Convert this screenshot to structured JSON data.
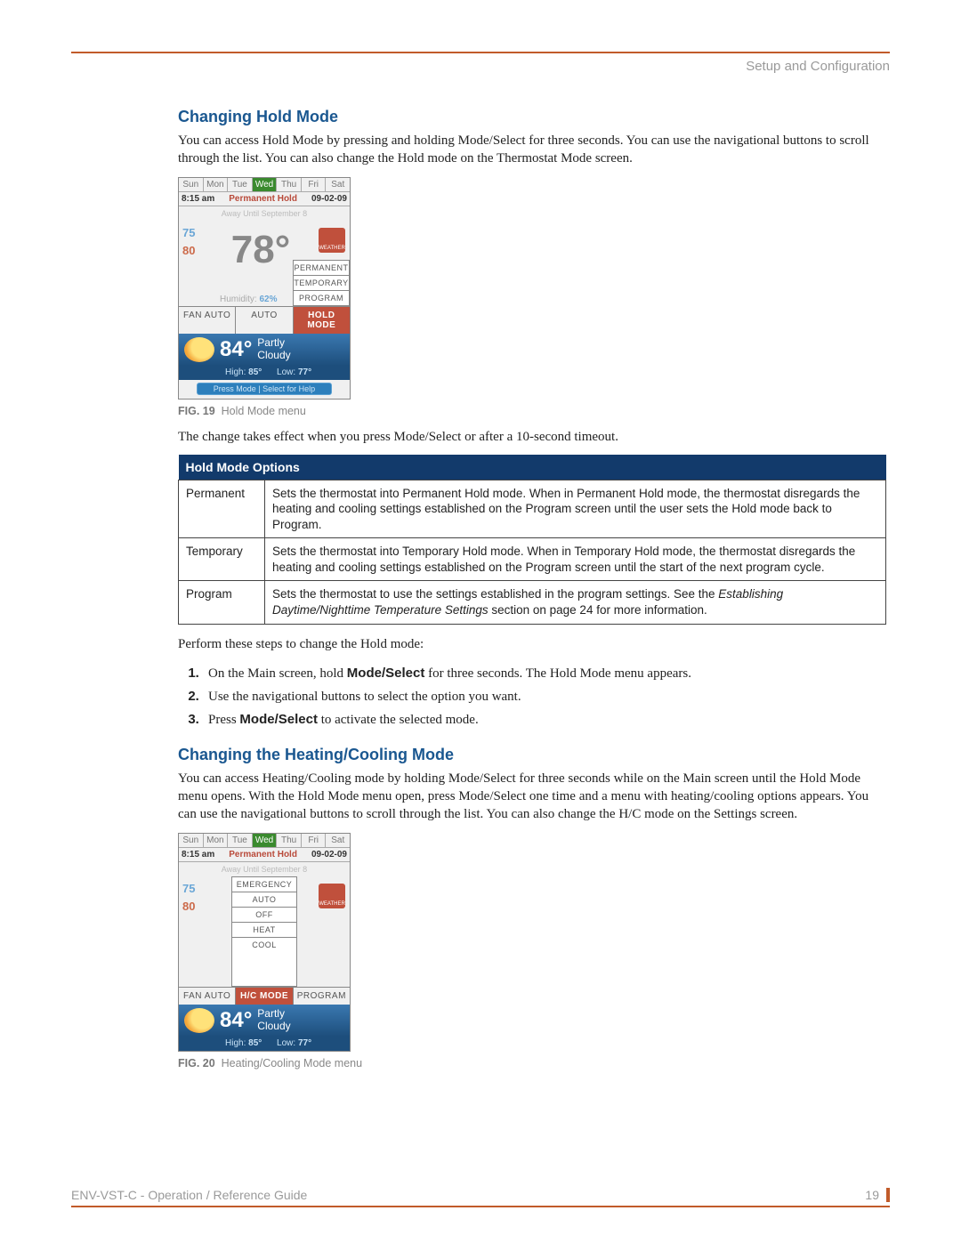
{
  "header": {
    "section_label": "Setup and Configuration"
  },
  "s1": {
    "heading": "Changing Hold Mode",
    "intro": "You can access Hold Mode by pressing and holding Mode/Select for three seconds. You can use the navigational buttons to scroll through the list. You can also change the Hold mode on the Thermostat Mode screen.",
    "after_fig": "The change takes effect when you press Mode/Select or after a 10-second timeout.",
    "perform": "Perform these steps to change the Hold mode:",
    "steps": {
      "a": {
        "pre": "On the Main screen, hold ",
        "bold": "Mode/Select",
        "post": " for three seconds. The Hold Mode menu appears."
      },
      "b": "Use the navigational buttons to select the option you want.",
      "c": {
        "pre": "Press ",
        "bold": "Mode/Select",
        "post": " to activate the selected mode."
      }
    }
  },
  "fig19": {
    "caption_label": "FIG. 19",
    "caption_text": "Hold Mode menu",
    "days": [
      "Sun",
      "Mon",
      "Tue",
      "Wed",
      "Thu",
      "Fri",
      "Sat"
    ],
    "selected_day_index": 3,
    "time": "8:15 am",
    "hold_label": "Permanent Hold",
    "date": "09-02-09",
    "away": "Away Until September 8",
    "set_cool": "75",
    "set_heat": "80",
    "big_temp": "78°",
    "humidity_label": "Humidity:",
    "humidity_val": "62%",
    "weather_box": "WEATHER",
    "menu": [
      "PERMANENT",
      "TEMPORARY",
      "PROGRAM"
    ],
    "bottom": {
      "fan": "FAN AUTO",
      "mid": "AUTO",
      "active": "HOLD MODE"
    },
    "wx": {
      "temp": "84°",
      "cond1": "Partly",
      "cond2": "Cloudy",
      "hi_label": "High:",
      "hi": "85°",
      "lo_label": "Low:",
      "lo": "77°"
    },
    "help": "Press Mode | Select for Help"
  },
  "table": {
    "title": "Hold Mode Options",
    "rows": [
      {
        "k": "Permanent",
        "v": "Sets the thermostat into Permanent Hold mode. When in Permanent Hold mode, the thermostat disregards the heating and cooling settings established on the Program screen until the user sets the Hold mode back to Program."
      },
      {
        "k": "Temporary",
        "v": "Sets the thermostat into Temporary Hold mode. When in Temporary Hold mode, the thermostat disregards the heating and cooling settings established on the Program screen until the start of the next program cycle."
      },
      {
        "k": "Program",
        "v_pre": "Sets the thermostat to use the settings established in the program settings. See the ",
        "v_em": "Establishing Daytime/Nighttime Temperature Settings",
        "v_post": " section on page 24 for more information."
      }
    ]
  },
  "s2": {
    "heading": "Changing the Heating/Cooling Mode",
    "intro": "You can access Heating/Cooling mode by holding Mode/Select for three seconds while on the Main screen until the Hold Mode menu opens. With the Hold Mode menu open, press Mode/Select one time and a menu with heating/cooling options appears. You can use the navigational buttons to scroll through the list. You can also change the H/C mode on the Settings screen."
  },
  "fig20": {
    "caption_label": "FIG. 20",
    "caption_text": "Heating/Cooling Mode menu",
    "menu": [
      "EMERGENCY",
      "AUTO",
      "OFF",
      "HEAT",
      "COOL"
    ],
    "bottom": {
      "fan": "FAN AUTO",
      "active": "H/C MODE",
      "right": "PROGRAM"
    }
  },
  "footer": {
    "left": "ENV-VST-C - Operation / Reference Guide",
    "page": "19"
  }
}
